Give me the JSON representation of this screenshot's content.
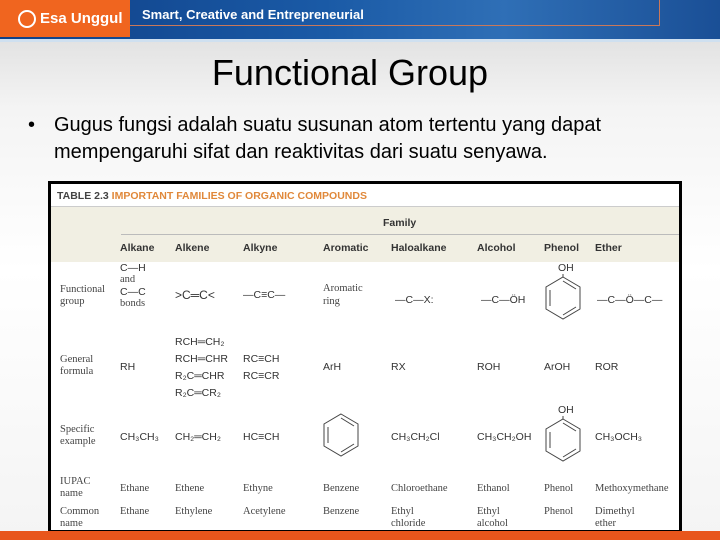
{
  "header": {
    "logo_small": "Universitas",
    "logo": "Esa Unggul",
    "tagline": "Smart, Creative and Entrepreneurial",
    "brand_color": "#f0651f",
    "band_color": "#1a5aa6"
  },
  "title": "Functional Group",
  "bullet": "Gugus fungsi adalah suatu susunan atom tertentu yang dapat mempengaruhi sifat dan reaktivitas dari suatu senyawa.",
  "table": {
    "caption_num": "TABLE 2.3",
    "caption": "IMPORTANT FAMILIES OF ORGANIC COMPOUNDS",
    "family": "Family",
    "columns": [
      "Alkane",
      "Alkene",
      "Alkyne",
      "Aromatic",
      "Haloalkane",
      "Alcohol",
      "Phenol",
      "Ether"
    ],
    "row_labels": [
      "Functional group",
      "General formula",
      "Specific example",
      "IUPAC name",
      "Common name"
    ],
    "functional_group": {
      "alkane": [
        "C—H",
        "and",
        "C—C",
        "bonds"
      ],
      "alkene": ">C═C<",
      "alkyne": "—C≡C—",
      "aromatic": [
        "Aromatic",
        "ring"
      ],
      "haloalkane": "—C—X:",
      "alcohol": "—C—ÖH",
      "phenol": "OH",
      "ether": "—C—Ö—C—"
    },
    "general_formula": {
      "alkane": "RH",
      "alkene": [
        "RCH═CH₂",
        "RCH═CHR",
        "R₂C═CHR",
        "R₂C═CR₂"
      ],
      "alkyne": [
        "RC≡CH",
        "RC≡CR"
      ],
      "aromatic": "ArH",
      "haloalkane": "RX",
      "alcohol": "ROH",
      "phenol": "ArOH",
      "ether": "ROR"
    },
    "specific_example": {
      "alkane": "CH₃CH₃",
      "alkene": "CH₂═CH₂",
      "alkyne": "HC≡CH",
      "haloalkane": "CH₃CH₂Cl",
      "alcohol": "CH₃CH₂OH",
      "phenol": "OH",
      "ether": "CH₃OCH₃"
    },
    "iupac": [
      "Ethane",
      "Ethene",
      "Ethyne",
      "Benzene",
      "Chloroethane",
      "Ethanol",
      "Phenol",
      "Methoxymethane"
    ],
    "common": [
      "Ethane",
      "Ethylene",
      "Acetylene",
      "Benzene",
      "Ethyl chloride",
      "Ethyl alcohol",
      "Phenol",
      "Dimethyl ether"
    ]
  }
}
